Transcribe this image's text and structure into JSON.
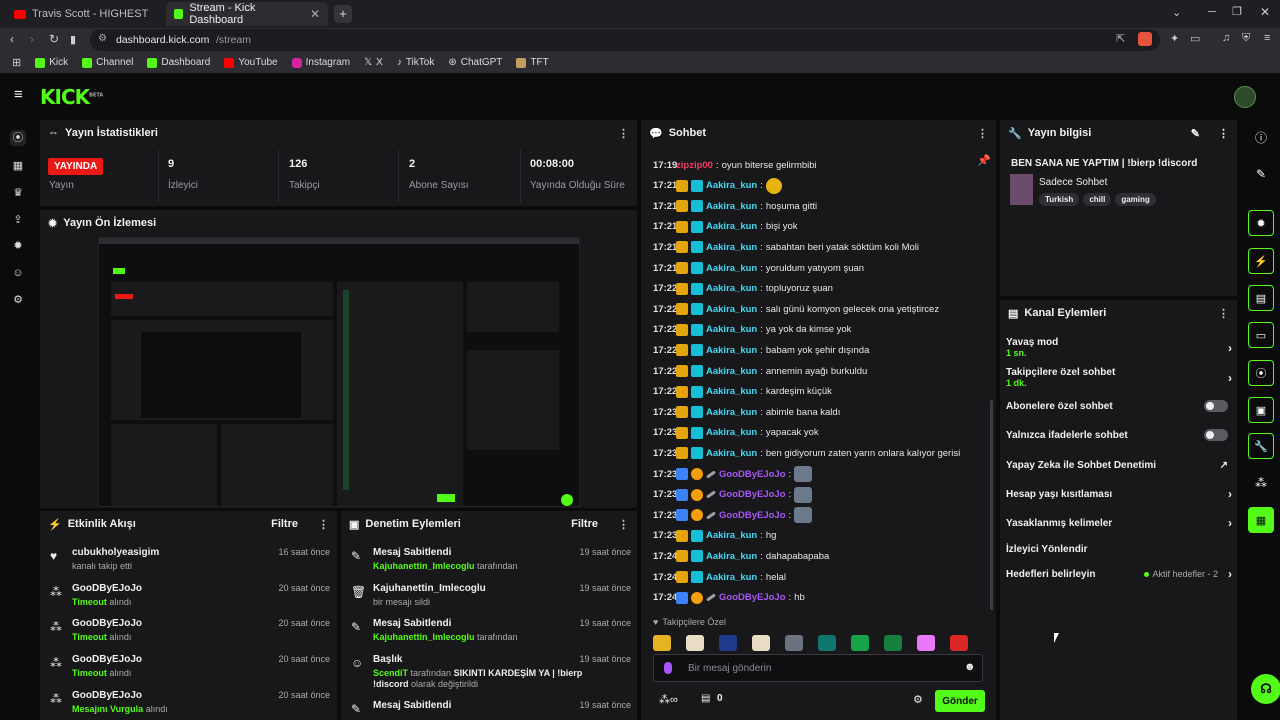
{
  "browser": {
    "tabs": [
      {
        "label": "Travis Scott - HIGHEST IN THE RO",
        "close": "✕"
      },
      {
        "label": "Stream - Kick Dashboard",
        "close": "✕"
      }
    ],
    "new_tab": "+",
    "url_host": "dashboard.kick.com",
    "url_path": "/stream",
    "bookmarks": [
      "Kick",
      "Channel",
      "Dashboard",
      "YouTube",
      "Instagram",
      "X",
      "TikTok",
      "ChatGPT",
      "TFT"
    ]
  },
  "app": {
    "logo": "KICK",
    "logo_badge": "BETA"
  },
  "stats": {
    "title": "Yayın İstatistikleri",
    "live_badge": "YAYINDA",
    "items": [
      {
        "value": "",
        "label": "Yayın"
      },
      {
        "value": "9",
        "label": "İzleyici"
      },
      {
        "value": "126",
        "label": "Takipçi"
      },
      {
        "value": "2",
        "label": "Abone Sayısı"
      },
      {
        "value": "00:08:00",
        "label": "Yayında Olduğu Süre"
      }
    ]
  },
  "preview": {
    "title": "Yayın Ön İzlemesi"
  },
  "events": {
    "title": "Etkinlik Akışı",
    "filter": "Filtre",
    "items": [
      {
        "name": "cubukholyeasigim",
        "pre": "",
        "action": "kanalı takip etti",
        "time": "16 saat önce"
      },
      {
        "name": "GooDByEJoJo",
        "pre": "Timeout",
        "action": "alındı",
        "time": "20 saat önce"
      },
      {
        "name": "GooDByEJoJo",
        "pre": "Timeout",
        "action": "alındı",
        "time": "20 saat önce"
      },
      {
        "name": "GooDByEJoJo",
        "pre": "Timeout",
        "action": "alındı",
        "time": "20 saat önce"
      },
      {
        "name": "GooDByEJoJo",
        "pre": "Mesajını Vurgula",
        "action": "alındı",
        "time": "20 saat önce"
      }
    ]
  },
  "moderation": {
    "title": "Denetim Eylemleri",
    "filter": "Filtre",
    "items": [
      {
        "name": "Mesaj Sabitlendi",
        "user": "Kajuhanettin_Imlecoglu",
        "action": "tarafından",
        "extra": "",
        "time": "19 saat önce"
      },
      {
        "name": "Kajuhanettin_Imlecoglu",
        "user": "",
        "action": "bir mesajı sildi",
        "extra": "",
        "time": "19 saat önce"
      },
      {
        "name": "Mesaj Sabitlendi",
        "user": "Kajuhanettin_Imlecoglu",
        "action": "tarafından",
        "extra": "",
        "time": "19 saat önce"
      },
      {
        "name": "Başlık",
        "user": "ScendiT",
        "action": "tarafından",
        "extra": "SIKINTI KARDEŞİM YA | !bierp !discord",
        "extra2": "olarak değiştirildi",
        "time": "19 saat önce"
      },
      {
        "name": "Mesaj Sabitlendi",
        "user": "",
        "action": "",
        "extra": "",
        "time": "19 saat önce"
      }
    ]
  },
  "chat": {
    "title": "Sohbet",
    "messages": [
      {
        "time": "17:19",
        "user": "zipzip00",
        "text": "oyun biterse gelirmbibi",
        "type": "zip"
      },
      {
        "time": "17:21",
        "user": "Aakira_kun",
        "text": "",
        "type": "ak",
        "emote": true
      },
      {
        "time": "17:21",
        "user": "Aakira_kun",
        "text": "hoşuma gitti",
        "type": "ak"
      },
      {
        "time": "17:21",
        "user": "Aakira_kun",
        "text": "bişi yok",
        "type": "ak"
      },
      {
        "time": "17:21",
        "user": "Aakira_kun",
        "text": "sabahtan beri yatak söktüm koli Moli",
        "type": "ak"
      },
      {
        "time": "17:21",
        "user": "Aakira_kun",
        "text": "yoruldum yatıyom şuan",
        "type": "ak"
      },
      {
        "time": "17:22",
        "user": "Aakira_kun",
        "text": "topluyoruz şuan",
        "type": "ak"
      },
      {
        "time": "17:22",
        "user": "Aakira_kun",
        "text": "salı günü komyon gelecek ona yetiştircez",
        "type": "ak"
      },
      {
        "time": "17:22",
        "user": "Aakira_kun",
        "text": "ya yok da kimse yok",
        "type": "ak"
      },
      {
        "time": "17:22",
        "user": "Aakira_kun",
        "text": "babam yok şehir dışında",
        "type": "ak"
      },
      {
        "time": "17:22",
        "user": "Aakira_kun",
        "text": "annemin ayağı burkuldu",
        "type": "ak"
      },
      {
        "time": "17:22",
        "user": "Aakira_kun",
        "text": "kardeşim küçük",
        "type": "ak"
      },
      {
        "time": "17:23",
        "user": "Aakira_kun",
        "text": "abimle bana kaldı",
        "type": "ak"
      },
      {
        "time": "17:23",
        "user": "Aakira_kun",
        "text": "yapacak yok",
        "type": "ak"
      },
      {
        "time": "17:23",
        "user": "Aakira_kun",
        "text": "ben gidiyorum zaten yarın onlara kalıyor gerisi",
        "type": "ak"
      },
      {
        "time": "17:23",
        "user": "GooDByEJoJo",
        "text": "",
        "type": "good",
        "emote": true
      },
      {
        "time": "17:23",
        "user": "GooDByEJoJo",
        "text": "",
        "type": "good",
        "emote": true
      },
      {
        "time": "17:23",
        "user": "GooDByEJoJo",
        "text": "",
        "type": "good",
        "emote": true
      },
      {
        "time": "17:23",
        "user": "Aakira_kun",
        "text": "hg",
        "type": "ak"
      },
      {
        "time": "17:24",
        "user": "Aakira_kun",
        "text": "dahapabapaba",
        "type": "ak"
      },
      {
        "time": "17:24",
        "user": "Aakira_kun",
        "text": "helal",
        "type": "ak"
      },
      {
        "time": "17:24",
        "user": "GooDByEJoJo",
        "text": "hb",
        "type": "good"
      }
    ],
    "followers_only": "Takipçilere Özel",
    "input_placeholder": "Bir mesaj gönderin",
    "points": "0",
    "send": "Gönder",
    "emote_colors": [
      "#e6b422",
      "#e9dcc4",
      "#1e3a8a",
      "#e9dcc4",
      "#6b7280",
      "#0f766e",
      "#16a34a",
      "#15803d",
      "#e879f9",
      "#dc2626"
    ]
  },
  "stream_info": {
    "title": "Yayın bilgisi",
    "stream_title": "BEN SANA NE YAPTIM | !bierp !discord",
    "category": "Sadece Sohbet",
    "tags": [
      "Turkish",
      "chill",
      "gaming"
    ]
  },
  "channel_actions": {
    "title": "Kanal Eylemleri",
    "items": [
      {
        "label": "Yavaş mod",
        "sub": "1 sn.",
        "control": "chevron"
      },
      {
        "label": "Takipçilere özel sohbet",
        "sub": "1 dk.",
        "control": "chevron"
      },
      {
        "label": "Abonelere özel sohbet",
        "sub": "",
        "control": "toggle"
      },
      {
        "label": "Yalnızca ifadelerle sohbet",
        "sub": "",
        "control": "toggle"
      },
      {
        "label": "Yapay Zeka ile Sohbet Denetimi",
        "sub": "",
        "control": "external"
      },
      {
        "label": "Hesap yaşı kısıtlaması",
        "sub": "",
        "control": "chevron"
      },
      {
        "label": "Yasaklanmış kelimeler",
        "sub": "",
        "control": "chevron"
      },
      {
        "label": "İzleyici Yönlendir",
        "sub": "",
        "control": "none"
      },
      {
        "label": "Hedefleri belirleyin",
        "sub": "",
        "control": "chevron",
        "status": "Aktif hedefler - 2"
      }
    ]
  },
  "colors": {
    "accent": "#53fc18",
    "live": "#e91916",
    "panel": "#18181b"
  }
}
